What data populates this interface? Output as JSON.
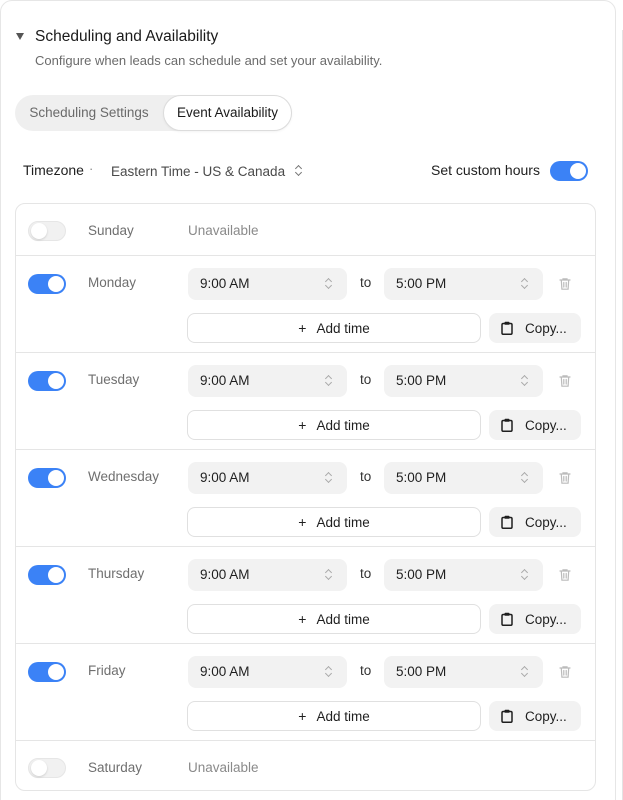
{
  "section": {
    "title": "Scheduling and Availability",
    "description": "Configure when leads can schedule and set your availability."
  },
  "tabs": [
    {
      "label": "Scheduling Settings",
      "active": false
    },
    {
      "label": "Event Availability",
      "active": true
    }
  ],
  "timezone": {
    "label": "Timezone",
    "separator": "·",
    "value": "Eastern Time - US & Canada"
  },
  "custom_hours": {
    "label": "Set custom hours",
    "enabled": true
  },
  "labels": {
    "to": "to",
    "add_time": "Add time",
    "copy": "Copy...",
    "unavailable": "Unavailable"
  },
  "days": [
    {
      "name": "Sunday",
      "enabled": false
    },
    {
      "name": "Monday",
      "enabled": true,
      "start": "9:00 AM",
      "end": "5:00 PM"
    },
    {
      "name": "Tuesday",
      "enabled": true,
      "start": "9:00 AM",
      "end": "5:00 PM"
    },
    {
      "name": "Wednesday",
      "enabled": true,
      "start": "9:00 AM",
      "end": "5:00 PM"
    },
    {
      "name": "Thursday",
      "enabled": true,
      "start": "9:00 AM",
      "end": "5:00 PM"
    },
    {
      "name": "Friday",
      "enabled": true,
      "start": "9:00 AM",
      "end": "5:00 PM"
    },
    {
      "name": "Saturday",
      "enabled": false
    }
  ],
  "colors": {
    "accent": "#3b82f6"
  }
}
